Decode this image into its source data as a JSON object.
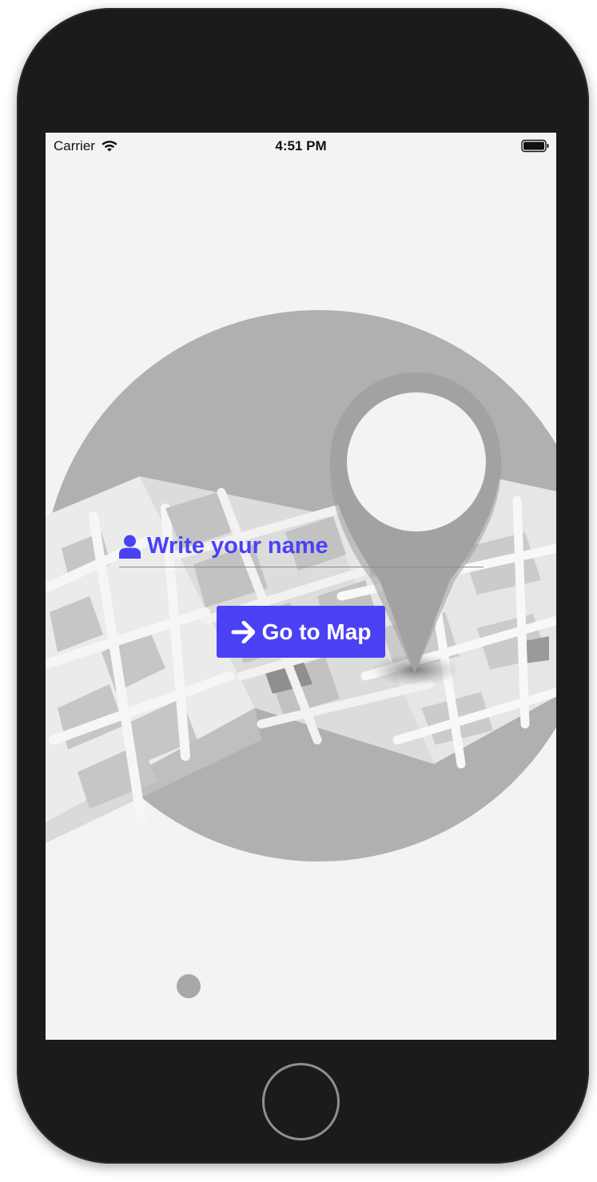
{
  "status_bar": {
    "carrier": "Carrier",
    "time": "4:51 PM"
  },
  "form": {
    "name_placeholder": "Write your name",
    "go_button_label": "Go to Map"
  },
  "icons": {
    "wifi": "wifi-icon",
    "battery": "battery-icon",
    "user": "user-icon",
    "arrow": "arrow-right-icon",
    "map_pin": "map-pin-icon"
  },
  "colors": {
    "accent": "#4a41f5",
    "screen_background": "#f3f3f3",
    "device_frame": "#1b1b1b"
  },
  "pagination": {
    "page_count": 1,
    "current_page": 1
  }
}
